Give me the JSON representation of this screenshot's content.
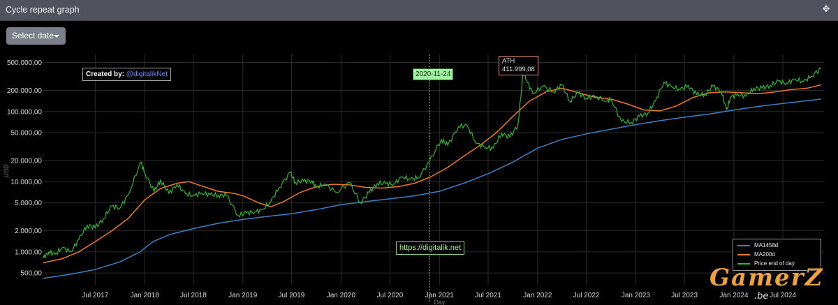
{
  "header": {
    "title": "Cycle repeat graph",
    "move_icon": "move-arrows-icon"
  },
  "controls": {
    "select_date_label": "Select date"
  },
  "annotations": {
    "credit_prefix": "Created by:",
    "credit_handle": "@digitalikNet",
    "date_marker": "2020-11-24",
    "ath_label": "ATH",
    "ath_value": "411.999,08",
    "url": "https://digitalik.net"
  },
  "watermark": {
    "text": "GamerZ",
    "sub": ".be"
  },
  "colors": {
    "ma1458": "#3b82c4",
    "ma200": "#f07a22",
    "price": "#2eb82e",
    "background": "#000000",
    "date_tag": "#a4f2a4"
  },
  "chart_data": {
    "type": "line",
    "y_scale": "log",
    "ylabel": "USD",
    "xlabel": "Day",
    "ylim": [
      340,
      650000
    ],
    "xlim": [
      "2016-12-20",
      "2024-12-01"
    ],
    "y_ticks": [
      {
        "value": 500,
        "label": "500,00"
      },
      {
        "value": 1000,
        "label": "1.000,00"
      },
      {
        "value": 2000,
        "label": "2.000,00"
      },
      {
        "value": 5000,
        "label": "5.000,00"
      },
      {
        "value": 10000,
        "label": "10.000,00"
      },
      {
        "value": 20000,
        "label": "20.000,00"
      },
      {
        "value": 50000,
        "label": "50.000,00"
      },
      {
        "value": 100000,
        "label": "100.000,00"
      },
      {
        "value": 200000,
        "label": "200.000,00"
      },
      {
        "value": 500000,
        "label": "500.000,00"
      }
    ],
    "x_ticks": [
      {
        "date": "2017-07-01",
        "label": "Jul 2017"
      },
      {
        "date": "2018-01-01",
        "label": "Jan 2018"
      },
      {
        "date": "2018-07-01",
        "label": "Jul 2018"
      },
      {
        "date": "2019-01-01",
        "label": "Jan 2019"
      },
      {
        "date": "2019-07-01",
        "label": "Jul 2019"
      },
      {
        "date": "2020-01-01",
        "label": "Jan 2020"
      },
      {
        "date": "2020-07-01",
        "label": "Jul 2020"
      },
      {
        "date": "2021-01-01",
        "label": "Jan 2021"
      },
      {
        "date": "2021-07-01",
        "label": "Jul 2021"
      },
      {
        "date": "2022-01-01",
        "label": "Jan 2022"
      },
      {
        "date": "2022-07-01",
        "label": "Jul 2022"
      },
      {
        "date": "2023-01-01",
        "label": "Jan 2023"
      },
      {
        "date": "2023-07-01",
        "label": "Jul 2023"
      },
      {
        "date": "2024-01-01",
        "label": "Jan 2024"
      },
      {
        "date": "2024-07-01",
        "label": "Jul 2024"
      }
    ],
    "vertical_marker": "2020-11-24",
    "ath_point": {
      "date": "2021-11-10",
      "value": 411999.08
    },
    "series": [
      {
        "name": "MA1458d",
        "color": "#3b82c4",
        "points": [
          [
            "2016-12-20",
            420
          ],
          [
            "2017-04-01",
            480
          ],
          [
            "2017-07-01",
            560
          ],
          [
            "2017-10-01",
            720
          ],
          [
            "2017-12-15",
            1000
          ],
          [
            "2018-02-01",
            1400
          ],
          [
            "2018-04-01",
            1750
          ],
          [
            "2018-07-01",
            2150
          ],
          [
            "2018-10-01",
            2550
          ],
          [
            "2019-01-01",
            2900
          ],
          [
            "2019-04-01",
            3200
          ],
          [
            "2019-07-01",
            3500
          ],
          [
            "2019-10-01",
            4000
          ],
          [
            "2020-01-01",
            4700
          ],
          [
            "2020-04-01",
            5200
          ],
          [
            "2020-07-01",
            5700
          ],
          [
            "2020-10-01",
            6300
          ],
          [
            "2021-01-01",
            7300
          ],
          [
            "2021-04-01",
            9500
          ],
          [
            "2021-07-01",
            13000
          ],
          [
            "2021-10-01",
            19000
          ],
          [
            "2022-01-01",
            30000
          ],
          [
            "2022-04-01",
            40000
          ],
          [
            "2022-07-01",
            48000
          ],
          [
            "2022-10-01",
            56000
          ],
          [
            "2023-01-01",
            65000
          ],
          [
            "2023-04-01",
            74000
          ],
          [
            "2023-07-01",
            83000
          ],
          [
            "2023-10-01",
            92000
          ],
          [
            "2024-01-01",
            105000
          ],
          [
            "2024-04-01",
            118000
          ],
          [
            "2024-07-01",
            130000
          ],
          [
            "2024-11-20",
            150000
          ]
        ]
      },
      {
        "name": "MA200d",
        "color": "#f07a22",
        "points": [
          [
            "2016-12-20",
            700
          ],
          [
            "2017-03-01",
            800
          ],
          [
            "2017-05-01",
            1000
          ],
          [
            "2017-07-01",
            1400
          ],
          [
            "2017-09-01",
            2000
          ],
          [
            "2017-11-01",
            3000
          ],
          [
            "2018-01-01",
            5500
          ],
          [
            "2018-03-01",
            8000
          ],
          [
            "2018-05-01",
            9500
          ],
          [
            "2018-06-15",
            10000
          ],
          [
            "2018-08-01",
            8700
          ],
          [
            "2018-10-01",
            7300
          ],
          [
            "2018-12-01",
            6800
          ],
          [
            "2019-01-01",
            6300
          ],
          [
            "2019-03-01",
            5000
          ],
          [
            "2019-04-15",
            4400
          ],
          [
            "2019-06-01",
            5200
          ],
          [
            "2019-08-01",
            7000
          ],
          [
            "2019-10-01",
            8500
          ],
          [
            "2019-12-01",
            9200
          ],
          [
            "2020-02-01",
            9000
          ],
          [
            "2020-04-01",
            8300
          ],
          [
            "2020-06-01",
            8100
          ],
          [
            "2020-08-01",
            8500
          ],
          [
            "2020-10-01",
            9500
          ],
          [
            "2020-12-01",
            11800
          ],
          [
            "2021-02-01",
            16000
          ],
          [
            "2021-04-01",
            23000
          ],
          [
            "2021-06-01",
            33000
          ],
          [
            "2021-08-01",
            50000
          ],
          [
            "2021-10-01",
            85000
          ],
          [
            "2021-12-01",
            140000
          ],
          [
            "2022-02-01",
            190000
          ],
          [
            "2022-04-01",
            215000
          ],
          [
            "2022-06-01",
            185000
          ],
          [
            "2022-08-01",
            160000
          ],
          [
            "2022-10-01",
            150000
          ],
          [
            "2022-12-01",
            128000
          ],
          [
            "2023-02-01",
            105000
          ],
          [
            "2023-04-01",
            102000
          ],
          [
            "2023-06-01",
            120000
          ],
          [
            "2023-08-01",
            158000
          ],
          [
            "2023-10-01",
            185000
          ],
          [
            "2023-12-01",
            190000
          ],
          [
            "2024-02-01",
            185000
          ],
          [
            "2024-04-01",
            180000
          ],
          [
            "2024-06-01",
            190000
          ],
          [
            "2024-08-01",
            205000
          ],
          [
            "2024-10-01",
            215000
          ],
          [
            "2024-11-20",
            240000
          ]
        ]
      },
      {
        "name": "Price end of day",
        "color": "#2eb82e",
        "points": [
          [
            "2016-12-20",
            820
          ],
          [
            "2017-01-10",
            1000
          ],
          [
            "2017-02-01",
            920
          ],
          [
            "2017-03-01",
            1150
          ],
          [
            "2017-04-01",
            1000
          ],
          [
            "2017-05-01",
            1500
          ],
          [
            "2017-06-01",
            2400
          ],
          [
            "2017-07-01",
            2200
          ],
          [
            "2017-08-01",
            3000
          ],
          [
            "2017-09-01",
            4500
          ],
          [
            "2017-10-01",
            4200
          ],
          [
            "2017-11-01",
            6500
          ],
          [
            "2017-12-17",
            19000
          ],
          [
            "2018-01-01",
            13500
          ],
          [
            "2018-02-05",
            7200
          ],
          [
            "2018-03-01",
            10500
          ],
          [
            "2018-04-01",
            6800
          ],
          [
            "2018-05-01",
            9200
          ],
          [
            "2018-06-01",
            6800
          ],
          [
            "2018-07-01",
            6300
          ],
          [
            "2018-08-01",
            6900
          ],
          [
            "2018-09-01",
            6500
          ],
          [
            "2018-10-01",
            6400
          ],
          [
            "2018-11-01",
            6400
          ],
          [
            "2018-12-15",
            3300
          ],
          [
            "2019-01-15",
            3600
          ],
          [
            "2019-02-15",
            3700
          ],
          [
            "2019-03-15",
            4000
          ],
          [
            "2019-04-15",
            5200
          ],
          [
            "2019-05-15",
            8200
          ],
          [
            "2019-06-26",
            13500
          ],
          [
            "2019-07-15",
            9800
          ],
          [
            "2019-08-15",
            10200
          ],
          [
            "2019-09-15",
            10300
          ],
          [
            "2019-10-01",
            8300
          ],
          [
            "2019-11-01",
            9300
          ],
          [
            "2019-12-15",
            7000
          ],
          [
            "2020-02-01",
            9800
          ],
          [
            "2020-03-13",
            5000
          ],
          [
            "2020-04-15",
            7000
          ],
          [
            "2020-05-15",
            9500
          ],
          [
            "2020-06-15",
            9400
          ],
          [
            "2020-07-15",
            9200
          ],
          [
            "2020-08-15",
            11800
          ],
          [
            "2020-09-15",
            10800
          ],
          [
            "2020-10-15",
            11500
          ],
          [
            "2020-11-24",
            19000
          ],
          [
            "2021-01-08",
            40000
          ],
          [
            "2021-02-01",
            33000
          ],
          [
            "2021-03-13",
            61000
          ],
          [
            "2021-04-14",
            63000
          ],
          [
            "2021-05-19",
            35000
          ],
          [
            "2021-06-20",
            31000
          ],
          [
            "2021-07-20",
            30000
          ],
          [
            "2021-08-20",
            49000
          ],
          [
            "2021-09-20",
            43000
          ],
          [
            "2021-10-20",
            65000
          ],
          [
            "2021-11-10",
            411999
          ],
          [
            "2021-11-20",
            280000
          ],
          [
            "2021-12-15",
            180000
          ],
          [
            "2022-01-20",
            230000
          ],
          [
            "2022-03-01",
            190000
          ],
          [
            "2022-04-01",
            240000
          ],
          [
            "2022-05-01",
            140000
          ],
          [
            "2022-06-01",
            185000
          ],
          [
            "2022-07-01",
            155000
          ],
          [
            "2022-08-01",
            165000
          ],
          [
            "2022-09-15",
            140000
          ],
          [
            "2022-10-01",
            150000
          ],
          [
            "2022-11-09",
            72000
          ],
          [
            "2022-12-15",
            70000
          ],
          [
            "2023-01-15",
            85000
          ],
          [
            "2023-02-15",
            95000
          ],
          [
            "2023-03-15",
            140000
          ],
          [
            "2023-04-15",
            260000
          ],
          [
            "2023-05-15",
            225000
          ],
          [
            "2023-06-15",
            205000
          ],
          [
            "2023-07-15",
            235000
          ],
          [
            "2023-08-15",
            175000
          ],
          [
            "2023-09-15",
            175000
          ],
          [
            "2023-10-15",
            230000
          ],
          [
            "2023-11-15",
            195000
          ],
          [
            "2023-12-05",
            105000
          ],
          [
            "2023-12-20",
            160000
          ],
          [
            "2024-01-15",
            175000
          ],
          [
            "2024-02-15",
            165000
          ],
          [
            "2024-03-15",
            215000
          ],
          [
            "2024-04-15",
            215000
          ],
          [
            "2024-05-15",
            235000
          ],
          [
            "2024-06-15",
            270000
          ],
          [
            "2024-07-15",
            250000
          ],
          [
            "2024-08-15",
            290000
          ],
          [
            "2024-09-15",
            265000
          ],
          [
            "2024-10-15",
            320000
          ],
          [
            "2024-11-20",
            410000
          ]
        ]
      }
    ],
    "legend": {
      "position": "bottom-right",
      "entries": [
        "MA1458d",
        "MA200d",
        "Price end of day"
      ]
    }
  }
}
